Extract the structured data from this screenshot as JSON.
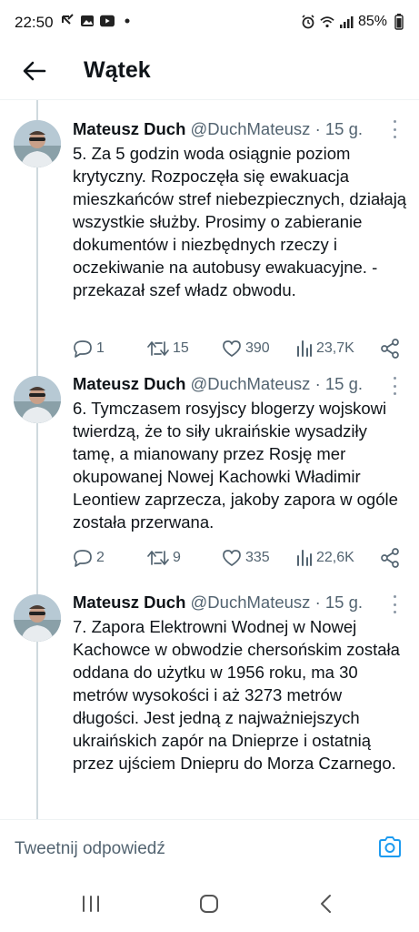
{
  "status_bar": {
    "time": "22:50",
    "battery": "85%",
    "left_icons": [
      "missed-call-icon",
      "image-icon",
      "youtube-icon",
      "dot-icon"
    ],
    "right_icons": [
      "alarm-icon",
      "wifi-icon",
      "signal-icon",
      "battery-icon"
    ]
  },
  "header": {
    "title": "Wątek",
    "back_icon": "arrow-left-icon"
  },
  "tweets": [
    {
      "name": "Mateusz Duch",
      "handle": "@DuchMateusz",
      "separator": "·",
      "time": "15 g.",
      "text": "5. Za 5 godzin woda osiągnie poziom krytyczny. Rozpoczęła się ewakuacja mieszkańców stref niebezpiecznych, działają wszystkie służby. Prosimy o zabieranie dokumentów i niezbędnych rzeczy i oczekiwanie na autobusy ewakuacyjne. - przekazał szef władz obwodu.",
      "replies": "1",
      "retweets": "15",
      "likes": "390",
      "views": "23,7K"
    },
    {
      "name": "Mateusz Duch",
      "handle": "@DuchMateusz",
      "separator": "·",
      "time": "15 g.",
      "text": "6. Tymczasem rosyjscy blogerzy wojskowi twierdzą, że to siły ukraińskie wysadziły tamę, a mianowany przez Rosję mer okupowanej Nowej Kachowki Władimir Leontiew zaprzecza, jakoby zapora w ogóle została przerwana.",
      "replies": "2",
      "retweets": "9",
      "likes": "335",
      "views": "22,6K"
    },
    {
      "name": "Mateusz Duch",
      "handle": "@DuchMateusz",
      "separator": "·",
      "time": "15 g.",
      "text": "7. Zapora Elektrowni Wodnej w Nowej Kachowce w obwodzie chersońskim została oddana do użytku w 1956 roku, ma 30 metrów wysokości i aż 3273 metrów długości. Jest jedną z najważniejszych ukraińskich zapór na Dnieprze i ostatnią przez ujściem Dniepru do Morza Czarnego."
    }
  ],
  "composer": {
    "placeholder": "Tweetnij odpowiedź",
    "camera_icon": "camera-icon"
  },
  "navbar": {
    "icons": [
      "recent-apps-icon",
      "home-icon",
      "back-icon"
    ]
  },
  "colors": {
    "accent": "#1d9bf0",
    "text_primary": "#0f1419",
    "text_secondary": "#536471",
    "thread_line": "#cfd9de"
  }
}
